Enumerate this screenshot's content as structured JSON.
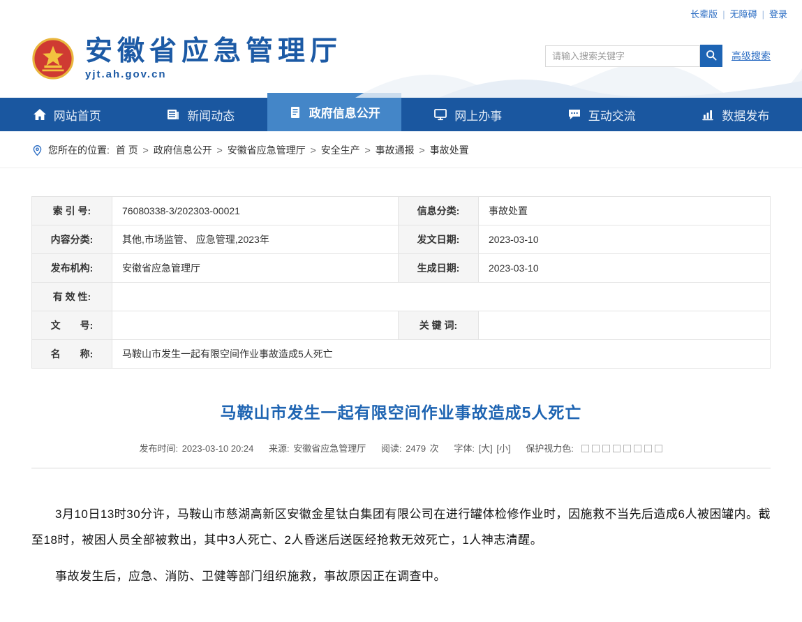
{
  "colors": {
    "nav_bg": "#1a57a0",
    "nav_active_bg": "#4486c8",
    "brand_blue": "#1c5aa5",
    "title_blue": "#1e64b2",
    "link_blue": "#2a6cc3",
    "emblem_red": "#cf3a32",
    "emblem_gold": "#e9b63d",
    "label_cell_bg": "#f5f5f5"
  },
  "topbar": {
    "separator": "|",
    "links": [
      "长辈版",
      "无障碍",
      "登录"
    ]
  },
  "header": {
    "site_name": "安徽省应急管理厅",
    "site_url": "yjt.ah.gov.cn",
    "search_placeholder": "请输入搜索关键字",
    "advanced_search_label": "高级搜索"
  },
  "nav": {
    "items": [
      {
        "label": "网站首页",
        "icon": "home-icon",
        "active": false
      },
      {
        "label": "新闻动态",
        "icon": "news-icon",
        "active": false
      },
      {
        "label": "政府信息公开",
        "icon": "document-icon",
        "active": true
      },
      {
        "label": "网上办事",
        "icon": "monitor-icon",
        "active": false
      },
      {
        "label": "互动交流",
        "icon": "chat-icon",
        "active": false
      },
      {
        "label": "数据发布",
        "icon": "chart-icon",
        "active": false
      }
    ]
  },
  "breadcrumb": {
    "prefix": "您所在的位置:",
    "separator": ">",
    "items": [
      "首 页",
      "政府信息公开",
      "安徽省应急管理厅",
      "安全生产",
      "事故通报",
      "事故处置"
    ]
  },
  "info_table": {
    "rows": [
      {
        "l1": "索 引 号:",
        "v1": "76080338-3/202303-00021",
        "l2": "信息分类:",
        "v2": "事故处置"
      },
      {
        "l1": "内容分类:",
        "v1": "其他,市场监管、 应急管理,2023年",
        "l2": "发文日期:",
        "v2": "2023-03-10"
      },
      {
        "l1": "发布机构:",
        "v1": "安徽省应急管理厅",
        "l2": "生成日期:",
        "v2": "2023-03-10"
      },
      {
        "l1": "有 效 性:",
        "v1": ""
      },
      {
        "l1": "文　　号:",
        "v1": "",
        "l2": "关 键 词:",
        "v2": ""
      },
      {
        "l1": "名　　称:",
        "v1": "马鞍山市发生一起有限空间作业事故造成5人死亡"
      }
    ]
  },
  "article": {
    "title": "马鞍山市发生一起有限空间作业事故造成5人死亡",
    "meta": {
      "publish_label": "发布时间:",
      "publish_time": "2023-03-10 20:24",
      "source_label": "来源:",
      "source": "安徽省应急管理厅",
      "views_label": "阅读:",
      "views": "2479",
      "views_unit": "次",
      "font_label": "字体:",
      "font_large": "[大]",
      "font_small": "[小]",
      "vision_label": "保护视力色:",
      "vision_colors": [
        "#ffffff",
        "#ffffff",
        "#ffffff",
        "#ffffff",
        "#ffffff",
        "#ffffff",
        "#ffffff",
        "#ffffff"
      ]
    },
    "paragraphs": [
      "3月10日13时30分许，马鞍山市慈湖高新区安徽金星钛白集团有限公司在进行罐体检修作业时，因施救不当先后造成6人被困罐内。截至18时，被困人员全部被救出，其中3人死亡、2人昏迷后送医经抢救无效死亡，1人神志清醒。",
      "事故发生后，应急、消防、卫健等部门组织施救，事故原因正在调查中。"
    ]
  }
}
